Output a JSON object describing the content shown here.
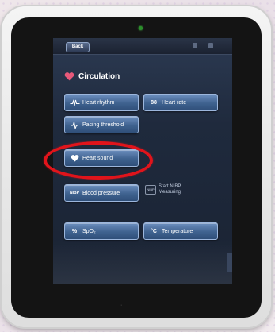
{
  "topbar": {
    "back_label": "Back",
    "title": ""
  },
  "section": {
    "title": "Circulation"
  },
  "buttons": {
    "heart_rhythm": "Heart rhythm",
    "heart_rate": "Heart rate",
    "pacing_threshold": "Pacing threshold",
    "heart_sound": "Heart sound",
    "blood_pressure": "Blood pressure",
    "spo2": "SpO₂",
    "temperature": "Temperature"
  },
  "nibp": {
    "icon_label": "NIBP",
    "start_label": "Start NIBP Measuring"
  },
  "annotation": {
    "color": "#e0141b",
    "target": "heart-sound-button"
  },
  "colors": {
    "button_top": "#6d8fbf",
    "button_bottom": "#2f4f79",
    "screen_bg": "#1f2a3d"
  },
  "icons": [
    "heart-icon",
    "ecg-icon",
    "heart-rate-icon",
    "pacing-icon",
    "blood-pressure-icon",
    "spo2-icon",
    "thermometer-icon"
  ]
}
